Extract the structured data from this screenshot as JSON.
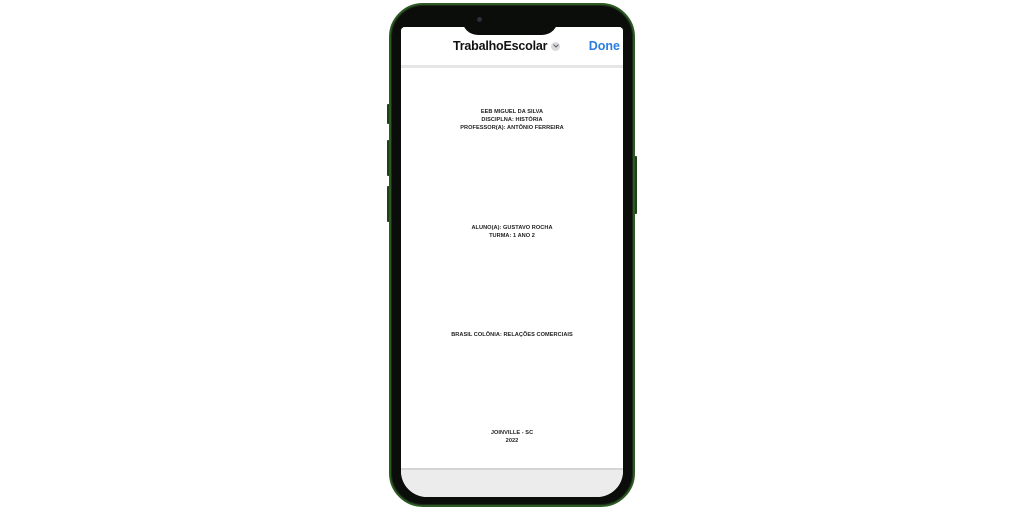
{
  "navbar": {
    "title": "TrabalhoEscolar",
    "done_label": "Done",
    "title_menu_icon": "chevron-down-icon"
  },
  "document": {
    "header_lines": [
      "EEB MIGUEL DA SILVA",
      "DISCIPLNA: HISTÓRIA",
      "PROFESSOR(A): ANTÔNIO FERREIRA"
    ],
    "student_lines": [
      "ALUNO(A): GUSTAVO ROCHA",
      "TURMA: 1 ANO 2"
    ],
    "title_line": "BRASIL COLÔNIA: RELAÇÕES COMERCIAIS",
    "footer_lines": [
      "JOINVILLE  - SC",
      "2022"
    ]
  },
  "colors": {
    "phone_frame": "#0b0d0b",
    "phone_edge": "#2d5a24",
    "done_blue": "#2a7de1",
    "text_dark": "#222222"
  }
}
